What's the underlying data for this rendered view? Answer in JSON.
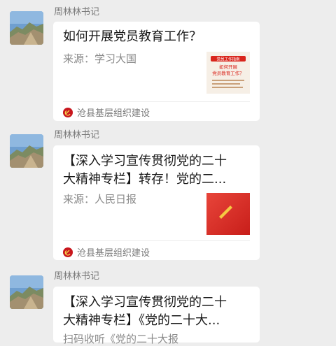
{
  "messages": [
    {
      "sender": "周林林书记",
      "title": "如何开展党员教育工作？",
      "source": "来源：学习大国",
      "thumb_text": {
        "tag": "党员工作指南",
        "line1": "如何开展",
        "line2": "党员教育工作？"
      },
      "account": "沧县基层组织建设"
    },
    {
      "sender": "周林林书记",
      "title": "【深入学习宣传贯彻党的二十\n大精神专栏】转存！党的二...",
      "source": "来源：人民日报",
      "account": "沧县基层组织建设"
    },
    {
      "sender": "周林林书记",
      "title": "【深入学习宣传贯彻党的二十\n大精神专栏】《党的二十大...",
      "source": "扫码收听《党的二十大报",
      "account": ""
    }
  ],
  "colors": {
    "background": "#ededed",
    "card": "#ffffff",
    "party_red": "#d9251c"
  }
}
